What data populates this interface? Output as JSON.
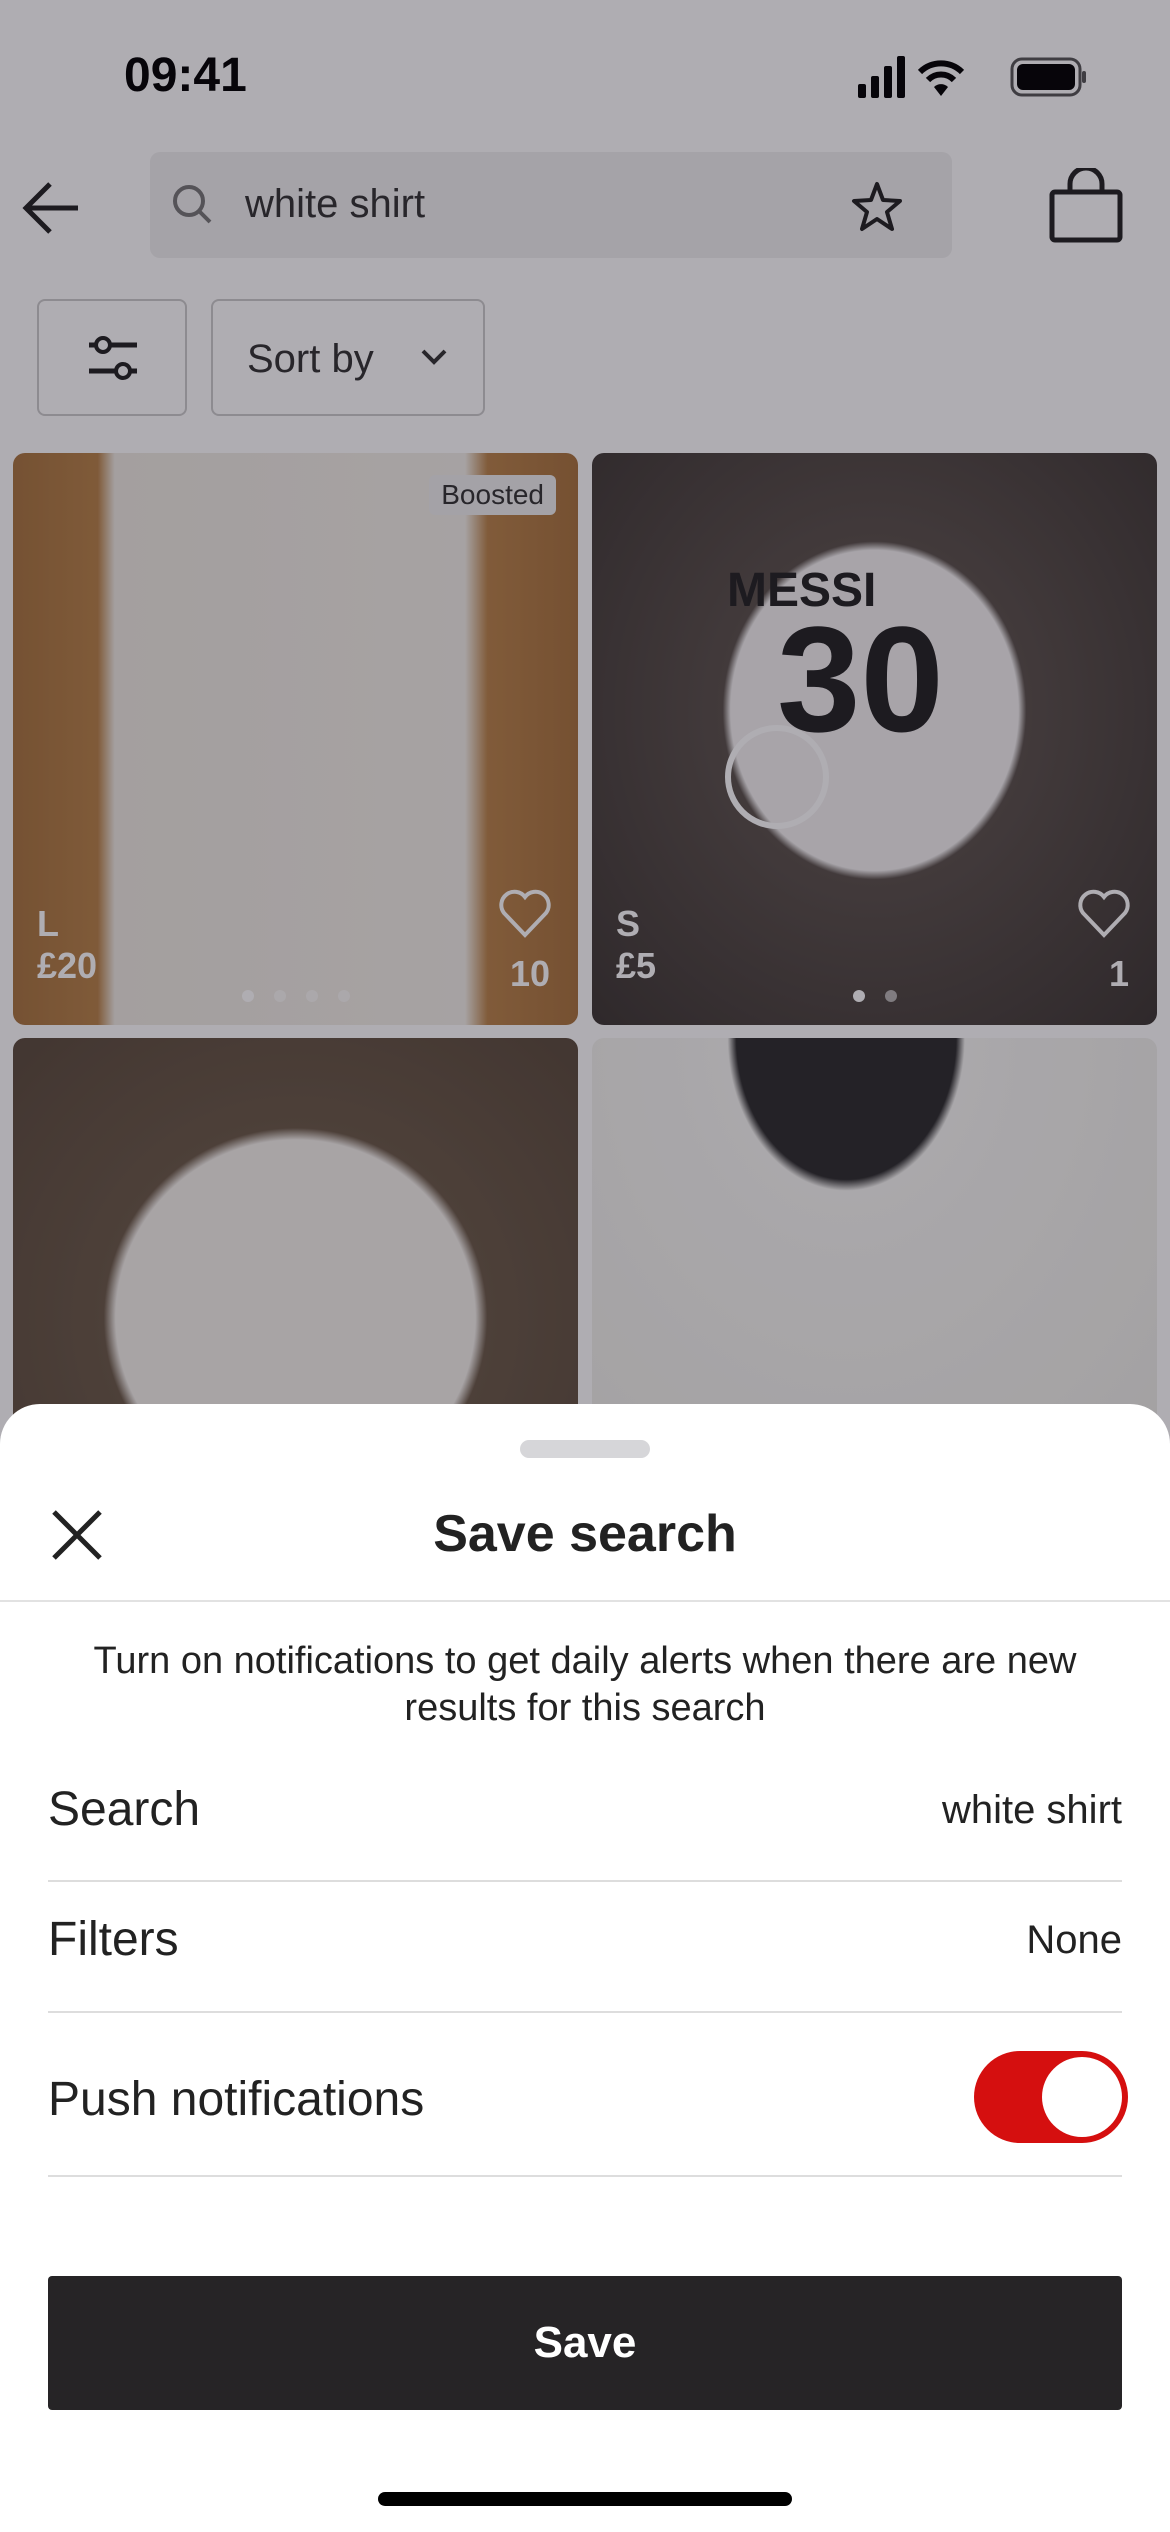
{
  "status_bar": {
    "time": "09:41"
  },
  "header": {
    "search_value": "white shirt",
    "icons": [
      "back-arrow-icon",
      "search-icon",
      "star-icon",
      "bag-icon"
    ]
  },
  "toolbar": {
    "sort_label": "Sort by"
  },
  "listings": [
    {
      "badge": "Boosted",
      "size": "L",
      "price": "£20",
      "likes": "10",
      "photo_count": 4
    },
    {
      "size": "S",
      "price": "£5",
      "likes": "1",
      "photo_count": 2
    },
    {},
    {}
  ],
  "sheet": {
    "title": "Save search",
    "description": "Turn on notifications to get daily alerts when there are new results for this search",
    "rows": [
      {
        "label": "Search",
        "value": "white shirt"
      },
      {
        "label": "Filters",
        "value": "None"
      },
      {
        "label": "Push notifications",
        "toggle_on": true
      }
    ],
    "save_label": "Save",
    "toggle_color": "#d50f0f"
  }
}
